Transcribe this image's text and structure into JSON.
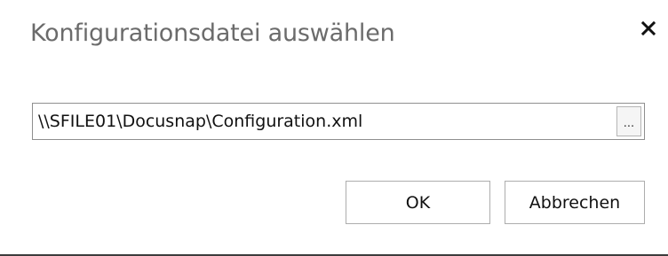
{
  "dialog": {
    "title": "Konfigurationsdatei auswählen",
    "close_icon": "close-icon"
  },
  "path": {
    "value": "\\\\SFILE01\\Docusnap\\Configuration.xml",
    "browse_label": "..."
  },
  "buttons": {
    "ok_label": "OK",
    "cancel_label": "Abbrechen"
  },
  "colors": {
    "title_text": "#6b6b6b",
    "border": "#8f8f8f",
    "button_border": "#adadad"
  }
}
